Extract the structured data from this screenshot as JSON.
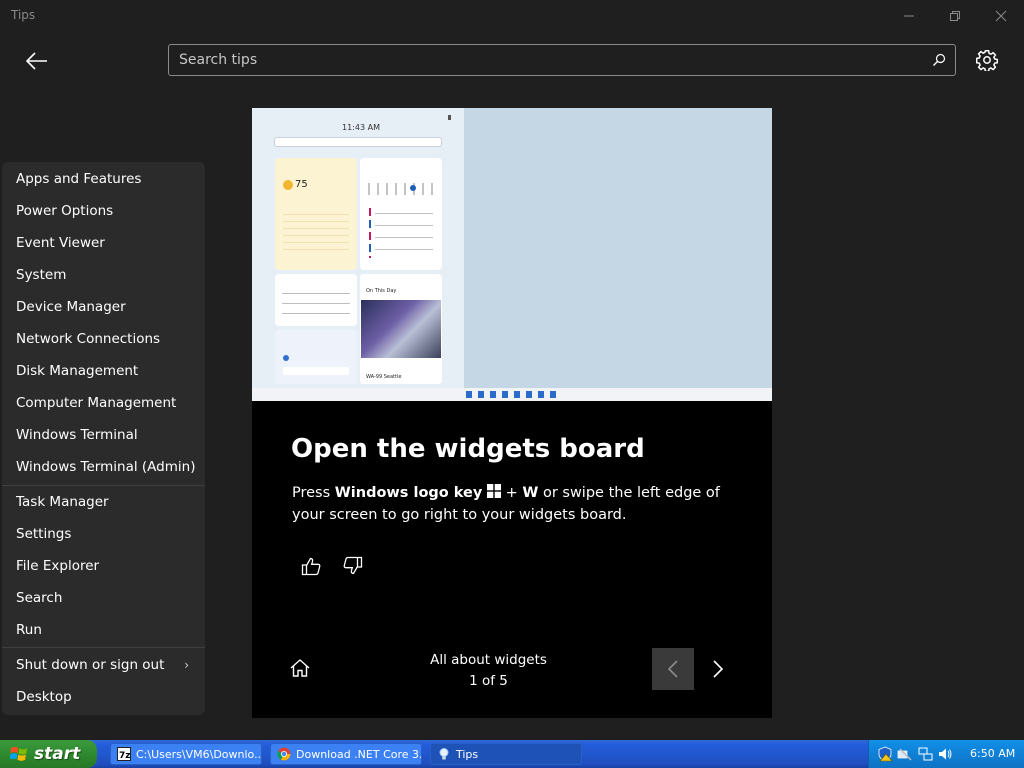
{
  "window": {
    "title": "Tips"
  },
  "header": {
    "search_placeholder": "Search tips"
  },
  "tip": {
    "title": "Open the widgets board",
    "desc_press": "Press",
    "desc_key": "Windows logo key",
    "desc_plus": "+",
    "desc_w": "W",
    "desc_rest": "or swipe the left edge of your screen to go right to your widgets board.",
    "collection": "All about widgets",
    "position": "1 of 5",
    "hero": {
      "clock": "11:43 AM",
      "weather_temp": "75",
      "on_this_day": "On This Day",
      "traffic_label": "WA-99 Seattle"
    }
  },
  "context_menu": {
    "items": [
      "Apps and Features",
      "Power Options",
      "Event Viewer",
      "System",
      "Device Manager",
      "Network Connections",
      "Disk Management",
      "Computer Management",
      "Windows Terminal",
      "Windows Terminal (Admin)",
      "Task Manager",
      "Settings",
      "File Explorer",
      "Search",
      "Run",
      "Shut down or sign out",
      "Desktop"
    ]
  },
  "taskbar": {
    "start_label": "start",
    "tasks": [
      "C:\\Users\\VM6\\Downlo...",
      "Download .NET Core 3....",
      "Tips"
    ],
    "clock": "6:50 AM"
  }
}
